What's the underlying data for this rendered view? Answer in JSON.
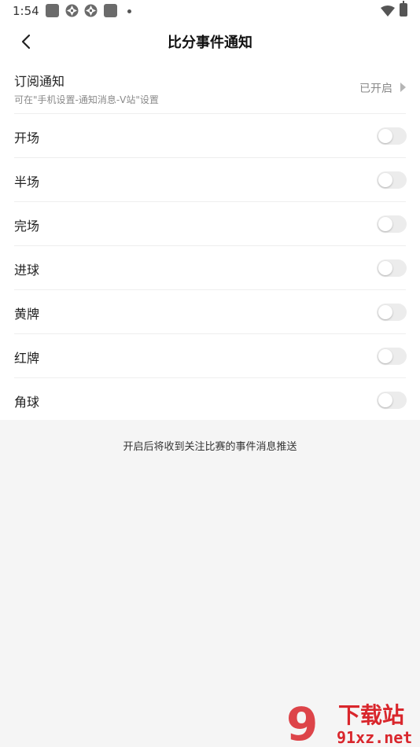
{
  "status_bar": {
    "time": "1:54",
    "icons": [
      "square-app-icon",
      "shutter-icon",
      "shutter-icon",
      "square-app-icon",
      "dot-icon",
      "wifi-icon",
      "battery-icon"
    ]
  },
  "header": {
    "title": "比分事件通知",
    "back_icon": "chevron-left-icon"
  },
  "subscription": {
    "title": "订阅通知",
    "subtitle": "可在\"手机设置-通知消息-V站\"设置",
    "status": "已开启"
  },
  "events": [
    {
      "label": "开场",
      "enabled": false
    },
    {
      "label": "半场",
      "enabled": false
    },
    {
      "label": "完场",
      "enabled": false
    },
    {
      "label": "进球",
      "enabled": false
    },
    {
      "label": "黄牌",
      "enabled": false
    },
    {
      "label": "红牌",
      "enabled": false
    },
    {
      "label": "角球",
      "enabled": false
    }
  ],
  "footer": {
    "hint": "开启后将收到关注比赛的事件消息推送"
  },
  "watermark": {
    "brand": "下载站",
    "site": "91xz.net",
    "logo": "9",
    "color": "#d9262c"
  },
  "colors": {
    "page_bg": "#f5f5f5",
    "panel_bg": "#ffffff",
    "toggle_off": "#ececec",
    "watermark_red": "#d9262c"
  }
}
